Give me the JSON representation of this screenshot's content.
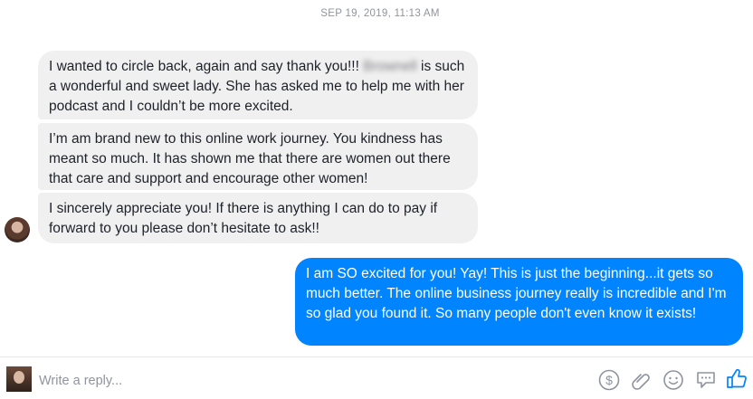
{
  "thread": {
    "timestamp": "SEP 19, 2019, 11:13 AM",
    "incoming": [
      {
        "before": "I wanted to circle back, again and say thank you!!! ",
        "redacted": "Brownell",
        "after": " is such a wonderful and sweet lady. She has asked me to help me with her podcast and I couldn’t be more excited."
      },
      {
        "text": "I’m am brand new to this online work journey. You kindness has meant so much. It has shown me that there are women out there that care and support and encourage other women!"
      },
      {
        "text": "I sincerely appreciate you! If there is anything I can do to pay if forward to you please don’t hesitate to ask!!"
      }
    ],
    "outgoing": [
      {
        "text": "I am SO excited for you! Yay! This is just the beginning...it gets so much better. The online business journey really is incredible and I'm so glad you found it. So many people don't even know it exists!"
      }
    ]
  },
  "composer": {
    "placeholder": "Write a reply...",
    "icons": [
      "payment-icon",
      "attach-icon",
      "emoji-icon",
      "sticker-icon",
      "like-icon"
    ]
  },
  "colors": {
    "accent": "#0084ff",
    "incoming_bubble": "#f1f0f0",
    "muted_text": "#90949c"
  }
}
